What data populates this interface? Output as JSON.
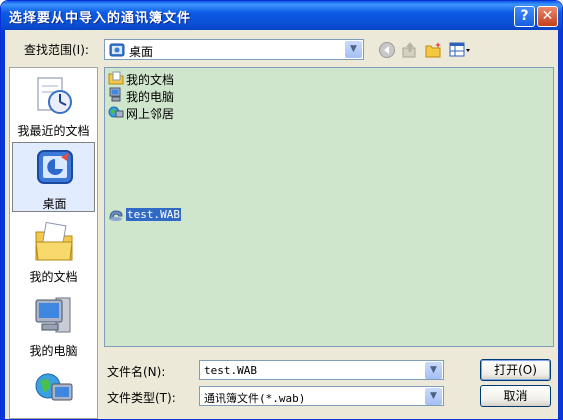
{
  "window": {
    "title": "选择要从中导入的通讯簿文件"
  },
  "titlebar_buttons": {
    "help": "?",
    "close": "✕"
  },
  "lookin": {
    "label": "查找范围(I):",
    "value": "桌面",
    "icon": "desktop-icon"
  },
  "toolbar_icons": [
    "back-icon",
    "up-folder-icon",
    "new-folder-icon",
    "view-menu-icon"
  ],
  "places": [
    {
      "label": "我最近的文档",
      "icon": "recent-documents-icon"
    },
    {
      "label": "桌面",
      "icon": "desktop-icon",
      "selected": true
    },
    {
      "label": "我的文档",
      "icon": "my-documents-icon"
    },
    {
      "label": "我的电脑",
      "icon": "my-computer-icon"
    },
    {
      "label": "",
      "icon": "network-places-icon"
    }
  ],
  "files": [
    {
      "name": "我的文档",
      "icon": "folder-icon"
    },
    {
      "name": "我的电脑",
      "icon": "computer-icon"
    },
    {
      "name": "网上邻居",
      "icon": "network-icon"
    },
    {
      "name": "test.WAB",
      "icon": "address-book-file-icon",
      "selected": true
    }
  ],
  "filename": {
    "label": "文件名(N):",
    "value": "test.WAB"
  },
  "filetype": {
    "label": "文件类型(T):",
    "value": "通讯簿文件(*.wab)"
  },
  "buttons": {
    "open": "打开(O)",
    "cancel": "取消"
  },
  "colors": {
    "title_bar": "#0a58e6",
    "file_list_bg": "#cfe6cc",
    "selection": "#316ac5"
  }
}
